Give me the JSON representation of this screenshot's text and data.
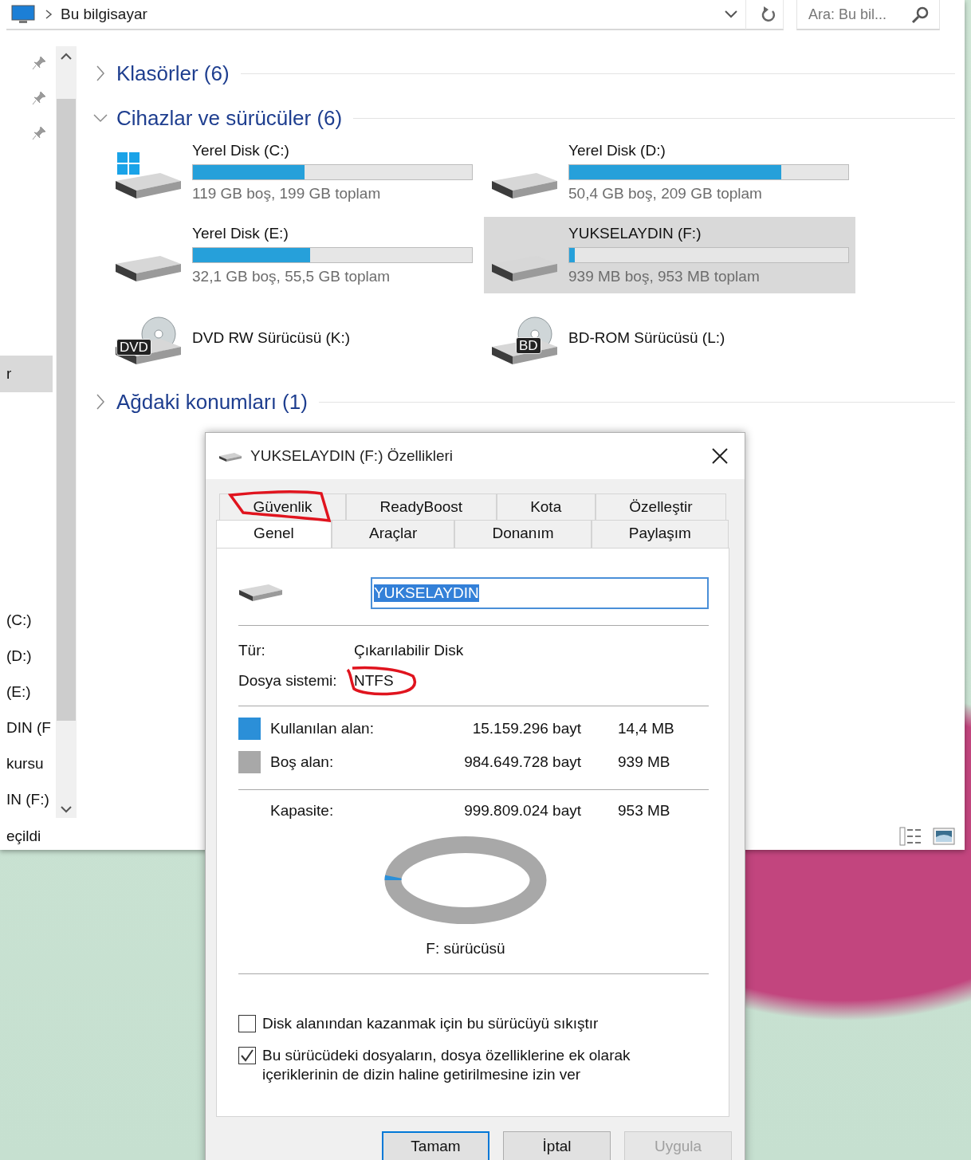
{
  "address_bar": {
    "location": "Bu bilgisayar",
    "search": {
      "placeholder": "Ara: Bu bil..."
    }
  },
  "navigation_pane": {
    "sections": [
      {
        "items": [
          {
            "label": "r",
            "selected": true
          }
        ]
      },
      {
        "items": [
          {
            "label": "(C:)",
            "selected": false
          },
          {
            "label": "(D:)",
            "selected": false
          },
          {
            "label": "(E:)",
            "selected": false
          },
          {
            "label": "DIN (F",
            "selected": false
          },
          {
            "label": "kursu",
            "selected": false
          },
          {
            "label": "IN (F:)",
            "selected": false
          }
        ]
      }
    ]
  },
  "groups": [
    {
      "title": "Klasörler (6)",
      "expanded": false
    },
    {
      "title": "Cihazlar ve sürücüler (6)",
      "expanded": true,
      "drives": [
        {
          "kind": "system",
          "name": "Yerel Disk (C:)",
          "level": 0.4,
          "free_text": "119 GB boş, 199 GB toplam",
          "selected": false
        },
        {
          "kind": "disk",
          "name": "Yerel Disk (D:)",
          "level": 0.76,
          "free_text": "50,4 GB boş, 209 GB toplam",
          "selected": false
        },
        {
          "kind": "disk",
          "name": "Yerel Disk (E:)",
          "level": 0.42,
          "free_text": "32,1 GB boş, 55,5 GB toplam",
          "selected": false
        },
        {
          "kind": "disk",
          "name": "YUKSELAYDIN (F:)",
          "level": 0.02,
          "free_text": "939 MB boş, 953 MB toplam",
          "selected": true
        },
        {
          "kind": "optical",
          "name": "DVD RW Sürücüsü (K:)",
          "badge": "DVD",
          "selected": false
        },
        {
          "kind": "optical",
          "name": "BD-ROM Sürücüsü (L:)",
          "badge": "BD",
          "selected": false
        }
      ]
    },
    {
      "title": "Ağdaki konumları (1)",
      "expanded": false
    }
  ],
  "status_bar": {
    "text": "eçildi"
  },
  "dialog": {
    "title": "YUKSELAYDIN (F:) Özellikleri",
    "tab_rows": [
      [
        {
          "label": "Güvenlik",
          "selected": false
        },
        {
          "label": "ReadyBoost",
          "selected": false
        },
        {
          "label": "Kota",
          "selected": false
        },
        {
          "label": "Özelleştir",
          "selected": false
        }
      ],
      [
        {
          "label": "Genel",
          "selected": true
        },
        {
          "label": "Araçlar",
          "selected": false
        },
        {
          "label": "Donanım",
          "selected": false
        },
        {
          "label": "Paylaşım",
          "selected": false
        }
      ]
    ],
    "volume_label": {
      "value": "YUKSELAYDIN",
      "highlighted": true
    },
    "properties": [
      {
        "label": "Tür:",
        "value": "Çıkarılabilir Disk"
      },
      {
        "label": "Dosya sistemi:",
        "value": "NTFS"
      }
    ],
    "usage": [
      {
        "label": "Kullanılan alan:",
        "bytes": "15.159.296 bayt",
        "size": "14,4 MB",
        "color": "#2b8fd8"
      },
      {
        "label": "Boş alan:",
        "bytes": "984.649.728 bayt",
        "size": "939 MB",
        "color": "#a8a8a8"
      }
    ],
    "capacity": {
      "label": "Kapasite:",
      "bytes": "999.809.024 bayt",
      "size": "953 MB"
    },
    "usage_ring": {
      "level": 0.015,
      "caption": "F: sürücüsü"
    },
    "checkboxes": [
      {
        "label": "Disk alanından kazanmak için bu sürücüyü sıkıştır",
        "checked": false
      },
      {
        "label": "Bu sürücüdeki dosyaların, dosya özelliklerine ek olarak\niçeriklerinin de dizin haline getirilmesine izin ver",
        "checked": true
      }
    ],
    "buttons": [
      {
        "label": "Tamam",
        "default": true,
        "disabled": false
      },
      {
        "label": "İptal",
        "default": false,
        "disabled": false
      },
      {
        "label": "Uygula",
        "default": false,
        "disabled": true
      }
    ]
  }
}
